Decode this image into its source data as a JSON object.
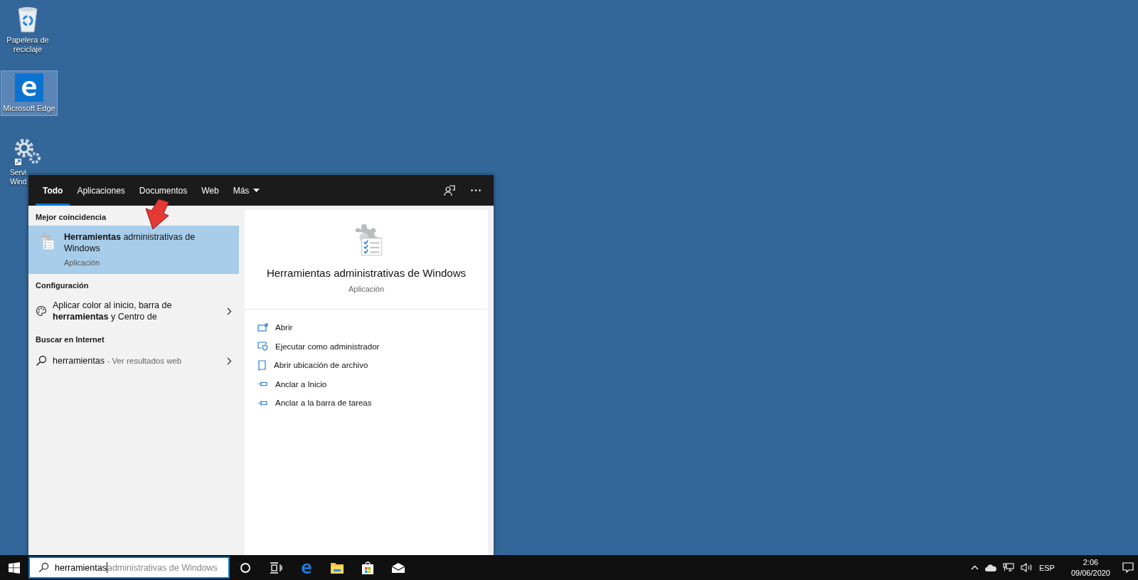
{
  "desktop_icons": [
    {
      "kind": "recycle",
      "lines": [
        "Papelera de",
        "reciclaje"
      ],
      "selected": false
    },
    {
      "kind": "edge",
      "lines": [
        "Microsoft Edge"
      ],
      "selected": true
    },
    {
      "kind": "gears",
      "lines": [
        "Servi",
        "Wind"
      ],
      "selected": false
    }
  ],
  "search_panel": {
    "tabs": [
      {
        "label": "Todo",
        "selected": true,
        "dropdown": false
      },
      {
        "label": "Aplicaciones",
        "selected": false,
        "dropdown": false
      },
      {
        "label": "Documentos",
        "selected": false,
        "dropdown": false
      },
      {
        "label": "Web",
        "selected": false,
        "dropdown": false
      },
      {
        "label": "Más",
        "selected": false,
        "dropdown": true
      }
    ],
    "best_match": {
      "heading": "Mejor coincidencia",
      "title": "**Herramientas** administrativas de Windows",
      "subtitle": "Aplicación",
      "selected": true
    },
    "sections": [
      {
        "heading": "Configuración",
        "items": [
          {
            "kind": "settings",
            "text": "Aplicar color al inicio, barra de **herramientas** y Centro de"
          }
        ]
      },
      {
        "heading": "Buscar en Internet",
        "items": [
          {
            "kind": "web",
            "text": "herramientas",
            "hint": "- Ver resultados web"
          }
        ]
      }
    ],
    "preview": {
      "title": "Herramientas administrativas de Windows",
      "subtitle": "Aplicación",
      "actions": [
        {
          "kind": "open",
          "label": "Abrir"
        },
        {
          "kind": "admin",
          "label": "Ejecutar como administrador"
        },
        {
          "kind": "folder",
          "label": "Abrir ubicación de archivo"
        },
        {
          "kind": "pin",
          "label": "Anclar a Inicio"
        },
        {
          "kind": "pin",
          "label": "Anclar a la barra de tareas"
        }
      ]
    }
  },
  "taskbar": {
    "search": {
      "value": "herramientas",
      "suggestion": "administrativas de Windows"
    },
    "apps": [
      {
        "kind": "cortana"
      },
      {
        "kind": "taskview"
      },
      {
        "kind": "edge"
      },
      {
        "kind": "explorer"
      },
      {
        "kind": "store"
      },
      {
        "kind": "mail"
      }
    ],
    "tray": {
      "language": "ESP",
      "time": "2:06",
      "date": "09/06/2020"
    }
  }
}
